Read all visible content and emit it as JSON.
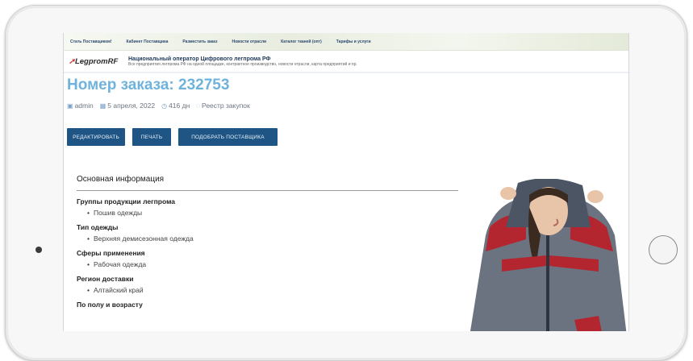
{
  "nav": [
    "Стать Поставщиком!",
    "Кабинет Поставщика",
    "Разместить заказ",
    "Новости отрасли",
    "Каталог тканей (опт)",
    "Тарифы и услуги"
  ],
  "brand": {
    "logo": "LegpromRF",
    "tagline": "Национальный оператор Цифрового легпрома РФ",
    "description": "Все предприятия легпрома РФ на одной площадке, контрактное производство, новости отрасли, карта предприятий и пр."
  },
  "order": {
    "title": "Номер заказа: 232753"
  },
  "meta": {
    "author": "admin",
    "date": "5 апреля, 2022",
    "age": "416 дн",
    "category": "Реестр закупок"
  },
  "buttons": {
    "edit": "РЕДАКТИРОВАТЬ",
    "print": "ПЕЧАТЬ",
    "pick": "ПОДОБРАТЬ ПОСТАВЩИКА"
  },
  "info": {
    "title": "Основная информация",
    "sections": [
      {
        "label": "Группы продукции легпрома",
        "value": "Пошив одежды"
      },
      {
        "label": "Тип одежды",
        "value": "Верхняя демисезонная одежда"
      },
      {
        "label": "Сферы применения",
        "value": "Рабочая одежда"
      },
      {
        "label": "Регион доставки",
        "value": "Алтайский край"
      },
      {
        "label": "По полу и возрасту",
        "value": ""
      }
    ]
  },
  "colors": {
    "accent": "#6fb3dd",
    "button": "#1f5585"
  }
}
